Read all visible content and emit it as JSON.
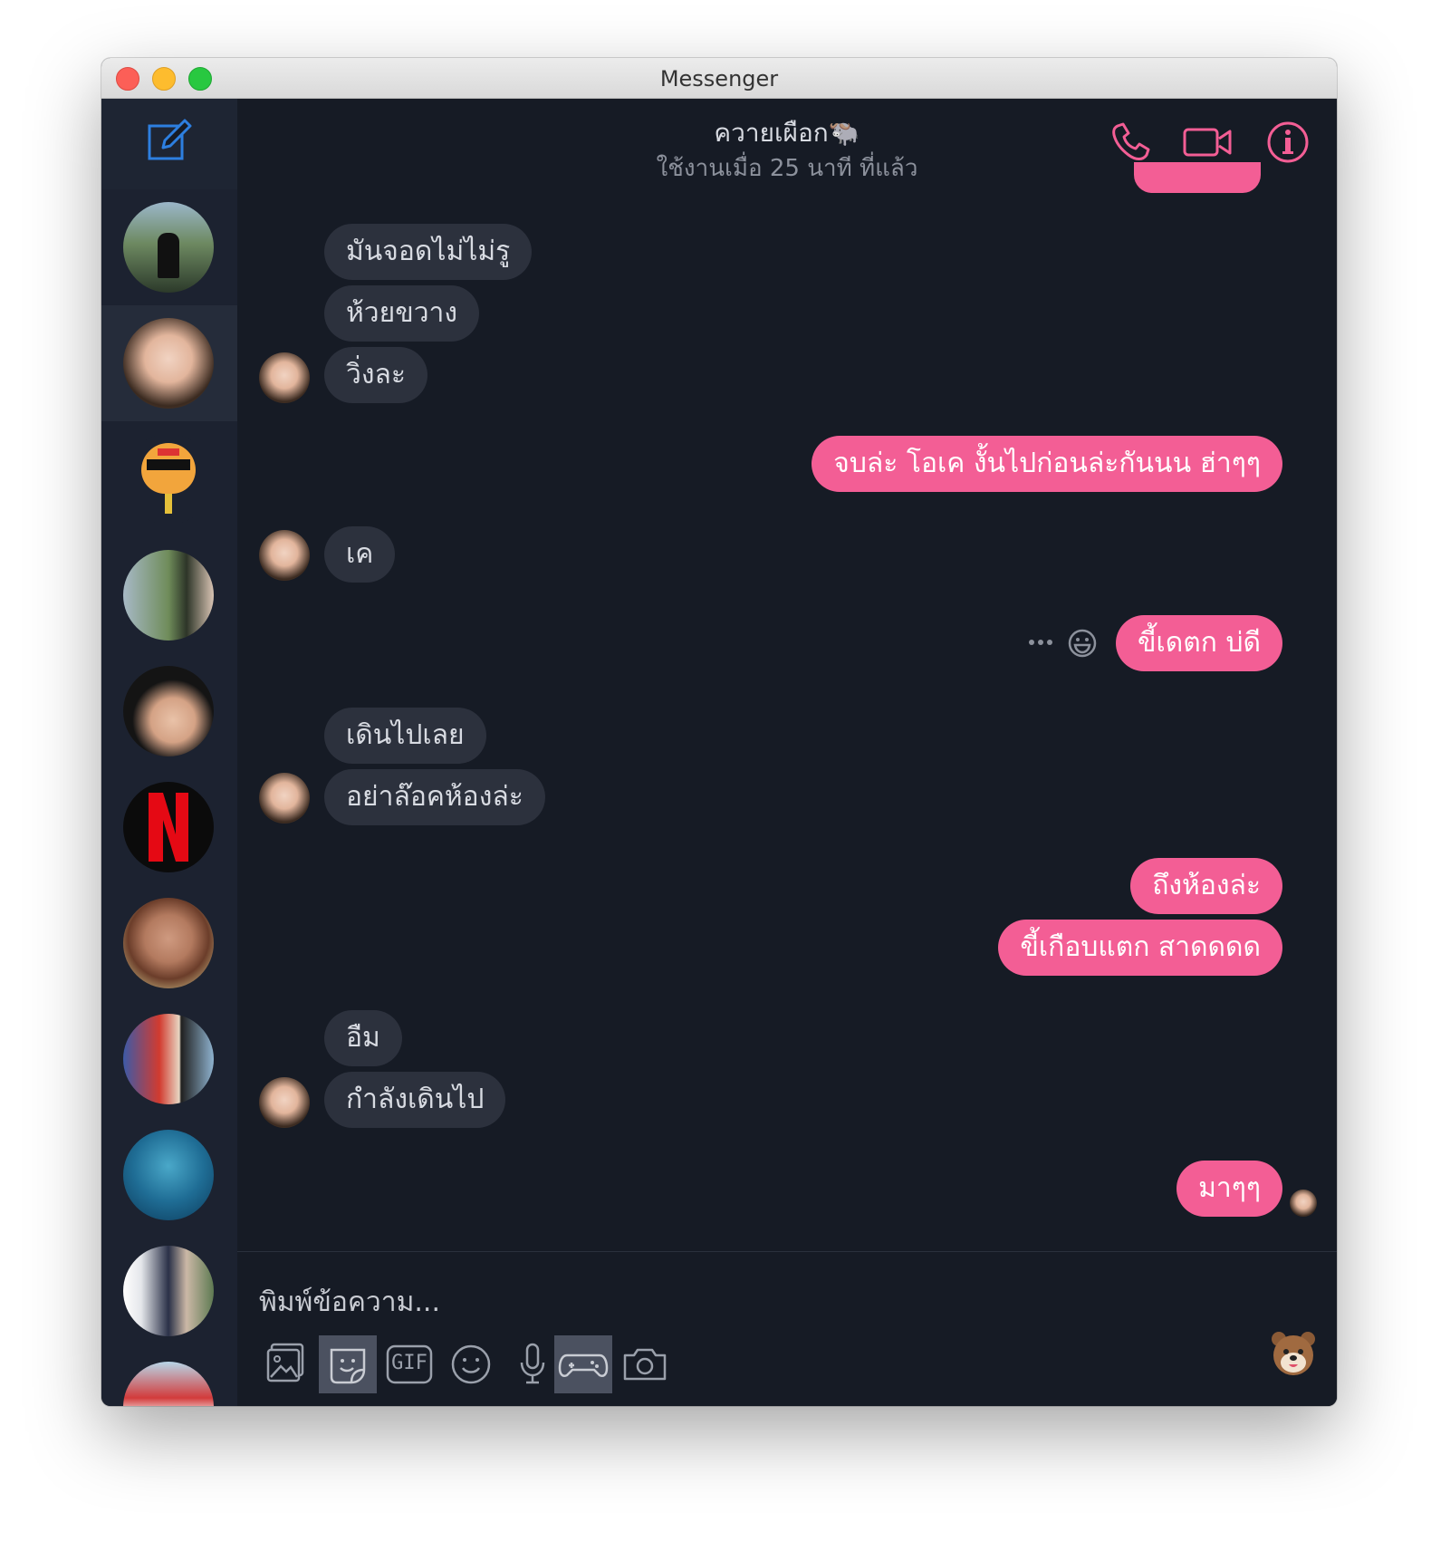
{
  "window": {
    "title": "Messenger"
  },
  "header": {
    "contact_name": "ควายเผือก🐃",
    "status": "ใช้งานเมื่อ 25 นาที ที่แล้ว"
  },
  "sidebar": {
    "conversations": [
      {
        "name": "conversation-1",
        "active": false
      },
      {
        "name": "conversation-2",
        "active": true
      },
      {
        "name": "conversation-3",
        "active": false
      },
      {
        "name": "conversation-4",
        "active": false
      },
      {
        "name": "conversation-5",
        "active": false
      },
      {
        "name": "conversation-6",
        "active": false
      },
      {
        "name": "conversation-7",
        "active": false
      },
      {
        "name": "conversation-8",
        "active": false
      },
      {
        "name": "conversation-9",
        "active": false
      },
      {
        "name": "conversation-10",
        "active": false
      },
      {
        "name": "conversation-11",
        "active": false
      }
    ]
  },
  "messages": [
    {
      "dir": "in",
      "text": "มันจอดไม่ไม่รู"
    },
    {
      "dir": "in",
      "text": "ห้วยขวาง"
    },
    {
      "dir": "in",
      "text": "วิ่งละ"
    },
    {
      "dir": "out",
      "text": "จบล่ะ โอเค งั้นไปก่อนล่ะกันนน ฮ่าๆๆ"
    },
    {
      "dir": "in",
      "text": "เค"
    },
    {
      "dir": "out",
      "text": "ขี้เดตก บ่ดี"
    },
    {
      "dir": "in",
      "text": "เดินไปเลย"
    },
    {
      "dir": "in",
      "text": "อย่าล๊อคห้องล่ะ"
    },
    {
      "dir": "out",
      "text": "ถึงห้องล่ะ"
    },
    {
      "dir": "out",
      "text": "ขี้เกือบแตก สาดดดด"
    },
    {
      "dir": "in",
      "text": "อืม"
    },
    {
      "dir": "in",
      "text": "กำลังเดินไป"
    },
    {
      "dir": "out",
      "text": "มาๆๆ"
    }
  ],
  "composer": {
    "placeholder": "พิมพ์ข้อความ...",
    "tools": [
      "image-icon",
      "sticker-icon",
      "gif-icon",
      "emoji-icon",
      "microphone-icon",
      "game-controller-icon",
      "camera-icon"
    ],
    "gif_label": "GIF",
    "reaction_emoji": "bear-icon"
  },
  "colors": {
    "accent": "#f35e95",
    "incoming_bubble": "#2c313d",
    "background": "#161b25",
    "compose_icon": "#2d7fe0"
  }
}
